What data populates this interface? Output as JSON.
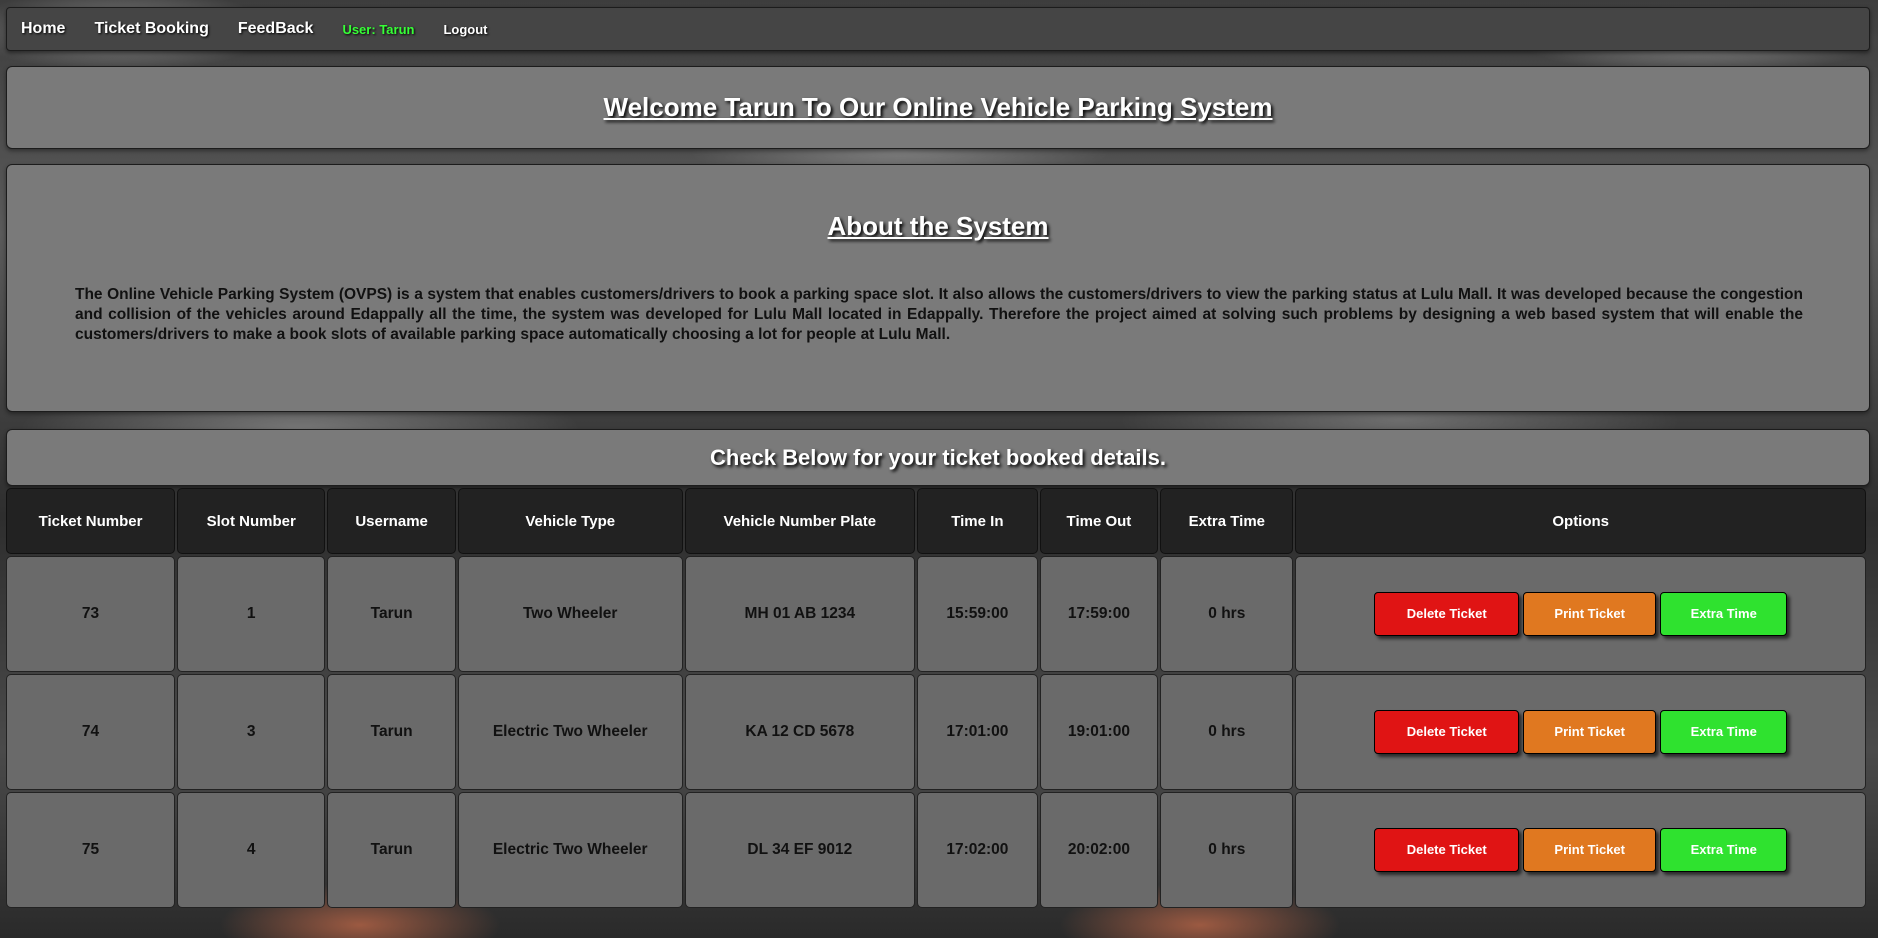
{
  "nav": {
    "home": "Home",
    "booking": "Ticket Booking",
    "feedback": "FeedBack",
    "user_label": "User:",
    "user_name": "Tarun",
    "logout": "Logout"
  },
  "welcome": {
    "title": "Welcome Tarun To Our Online Vehicle Parking System"
  },
  "about": {
    "title": "About the System",
    "text": "The Online Vehicle Parking System (OVPS) is a system that enables customers/drivers to book a parking space slot. It also allows the customers/drivers to view the parking status at Lulu Mall. It was developed because the congestion and collision of the vehicles around Edappally all the time, the system was developed for Lulu Mall located in Edappally. Therefore the project aimed at solving such problems by designing a web based system that will enable the customers/drivers to make a book slots of available parking space automatically choosing a lot for people at Lulu Mall."
  },
  "tickets": {
    "heading": "Check Below for your ticket booked details.",
    "columns": [
      "Ticket Number",
      "Slot Number",
      "Username",
      "Vehicle Type",
      "Vehicle Number Plate",
      "Time In",
      "Time Out",
      "Extra Time",
      "Options"
    ],
    "rows": [
      [
        "73",
        "1",
        "Tarun",
        "Two Wheeler",
        "MH 01 AB 1234",
        "15:59:00",
        "17:59:00",
        "0 hrs"
      ],
      [
        "74",
        "3",
        "Tarun",
        "Electric Two Wheeler",
        "KA 12 CD 5678",
        "17:01:00",
        "19:01:00",
        "0 hrs"
      ],
      [
        "75",
        "4",
        "Tarun",
        "Electric Two Wheeler",
        "DL 34 EF 9012",
        "17:02:00",
        "20:02:00",
        "0 hrs"
      ]
    ],
    "buttons": {
      "delete": "Delete Ticket",
      "print": "Print Ticket",
      "extra": "Extra Time"
    }
  },
  "colors": {
    "delete": "#e01414",
    "print": "#e07820",
    "extra": "#2fe22f",
    "user_highlight": "#37ff37"
  }
}
